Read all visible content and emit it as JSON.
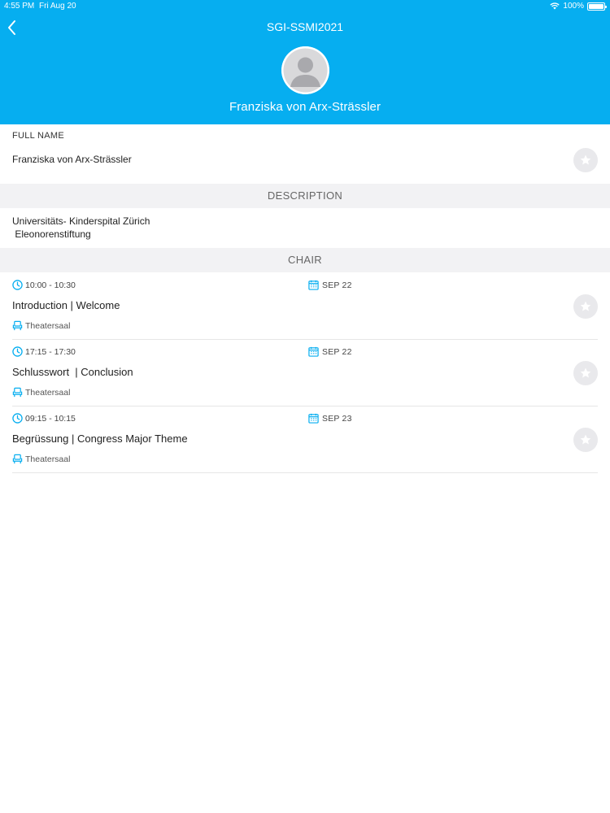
{
  "status_bar": {
    "time": "4:55 PM",
    "date": "Fri Aug 20",
    "battery": "100%"
  },
  "header": {
    "title": "SGI-SSMI2021",
    "name": "Franziska von Arx-Strässler"
  },
  "full_name": {
    "label": "FULL NAME",
    "value": "Franziska von Arx-Strässler"
  },
  "description": {
    "header": "DESCRIPTION",
    "lines": [
      "Universitäts- Kinderspital Zürich",
      " Eleonorenstiftung"
    ]
  },
  "chair": {
    "header": "CHAIR",
    "sessions": [
      {
        "time": "10:00 - 10:30",
        "date": "SEP 22",
        "title": "Introduction | Welcome",
        "room": "Theatersaal"
      },
      {
        "time": "17:15 - 17:30",
        "date": "SEP 22",
        "title": "Schlusswort  | Conclusion",
        "room": "Theatersaal"
      },
      {
        "time": "09:15 - 10:15",
        "date": "SEP 23",
        "title": "Begrüssung | Congress Major Theme",
        "room": "Theatersaal"
      }
    ]
  },
  "colors": {
    "accent": "#06aef0",
    "section_bg": "#f2f2f4",
    "star_bg": "#e9e9ec"
  }
}
